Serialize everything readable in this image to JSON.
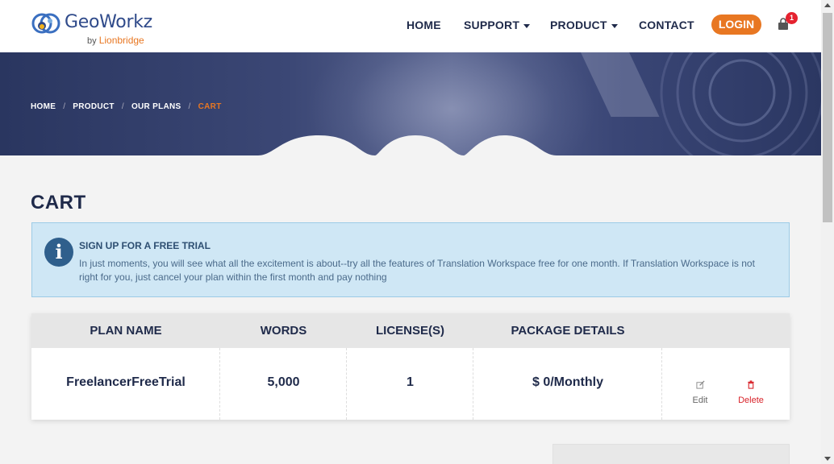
{
  "brand": {
    "name": "GeoWorkz",
    "by": "by",
    "company": "Lionbridge"
  },
  "nav": {
    "home": "HOME",
    "support": "SUPPORT",
    "product": "PRODUCT",
    "contact": "CONTACT",
    "login": "LOGIN",
    "cart_count": "1"
  },
  "breadcrumb": {
    "items": [
      "HOME",
      "PRODUCT",
      "OUR PLANS",
      "CART"
    ],
    "separator": "/"
  },
  "page": {
    "title": "CART"
  },
  "info": {
    "title": "SIGN UP FOR A FREE TRIAL",
    "text": "In just moments, you will see what all the excitement is about--try all the features of Translation Workspace free for one month. If Translation Workspace is not right for you, just cancel your plan within the first month and pay nothing"
  },
  "table": {
    "headers": [
      "PLAN NAME",
      "WORDS",
      "LICENSE(S)",
      "PACKAGE DETAILS"
    ],
    "rows": [
      {
        "plan_name": "FreelancerFreeTrial",
        "words": "5,000",
        "licenses": "1",
        "package_details": "$ 0/Monthly",
        "edit": "Edit",
        "delete": "Delete"
      }
    ]
  },
  "colors": {
    "accent": "#e87722",
    "navy": "#1f2a4a",
    "danger": "#d8232a",
    "info_bg": "#cfe7f5"
  }
}
